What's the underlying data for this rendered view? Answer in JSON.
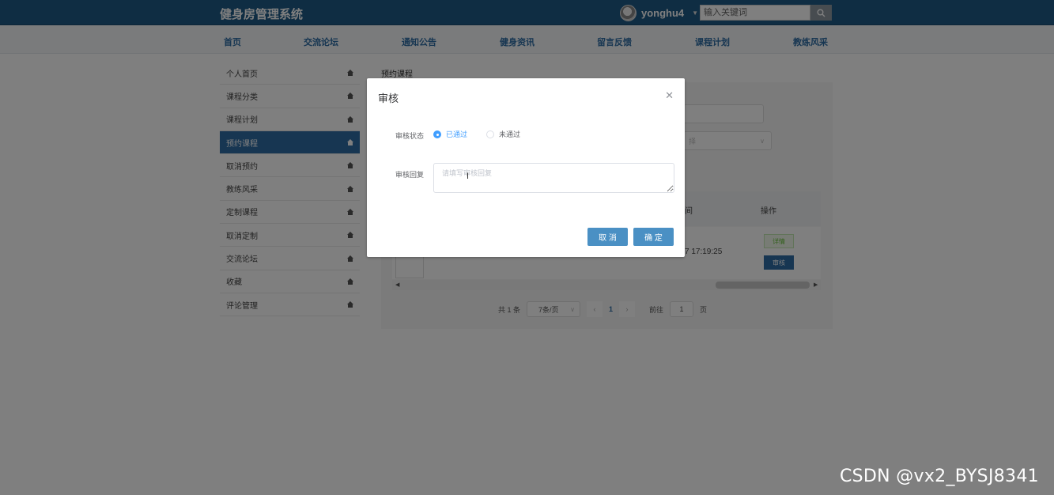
{
  "header": {
    "brand": "健身房管理系统",
    "username": "yonghu4",
    "search_placeholder": "输入关键词"
  },
  "nav": [
    "首页",
    "交流论坛",
    "通知公告",
    "健身资讯",
    "留言反馈",
    "课程计划",
    "教练风采"
  ],
  "sidebar": [
    {
      "label": "个人首页",
      "active": false
    },
    {
      "label": "课程分类",
      "active": false
    },
    {
      "label": "课程计划",
      "active": false
    },
    {
      "label": "预约课程",
      "active": true
    },
    {
      "label": "取消预约",
      "active": false
    },
    {
      "label": "教练风采",
      "active": false
    },
    {
      "label": "定制课程",
      "active": false
    },
    {
      "label": "取消定制",
      "active": false
    },
    {
      "label": "交流论坛",
      "active": false
    },
    {
      "label": "收藏",
      "active": false
    },
    {
      "label": "评论管理",
      "active": false
    }
  ],
  "main": {
    "breadcrumb": "预约课程",
    "partial_select_text": "择",
    "table_col_partial": "间",
    "table_op_header": "操作",
    "row_time": "7 17:19:25",
    "detail_btn": "详情",
    "audit_btn": "审核"
  },
  "pagination": {
    "total": "共 1 条",
    "page_size": "7条/页",
    "current_page": "1",
    "goto_label": "前往",
    "goto_value": "1",
    "page_suffix": "页"
  },
  "dialog": {
    "title": "审核",
    "status_label": "审核状态",
    "option_pass": "已通过",
    "option_fail": "未通过",
    "selected": "已通过",
    "reply_label": "审核回复",
    "reply_placeholder": "请填写审核回复",
    "cancel_label": "取 消",
    "confirm_label": "确 定"
  },
  "watermark": "CSDN @vx2_BYSJ8341",
  "colors": {
    "header_bg": "#1f5b86",
    "accent": "#2e6da4",
    "primary": "#409eff",
    "dialog_btn": "#4a90c4"
  }
}
